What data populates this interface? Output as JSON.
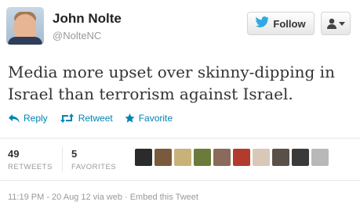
{
  "user": {
    "name": "John Nolte",
    "handle": "@NolteNC"
  },
  "buttons": {
    "follow_label": "Follow"
  },
  "tweet": {
    "text": "Media more upset over skinny-dipping in Israel than terrorism against Israel."
  },
  "actions": {
    "reply": "Reply",
    "retweet": "Retweet",
    "favorite": "Favorite"
  },
  "stats": {
    "retweets_count": "49",
    "retweets_label": "RETWEETS",
    "favorites_count": "5",
    "favorites_label": "FAVORITES"
  },
  "faces": [
    {
      "color": "#2b2b2b"
    },
    {
      "color": "#7a5a3c"
    },
    {
      "color": "#c9b27a"
    },
    {
      "color": "#6b7b3a"
    },
    {
      "color": "#8a6a5a"
    },
    {
      "color": "#b23b2e"
    },
    {
      "color": "#d9c7b8"
    },
    {
      "color": "#5a5048"
    },
    {
      "color": "#3a3a3a"
    },
    {
      "color": "#b8b8b8"
    }
  ],
  "meta": {
    "text": "11:19 PM - 20 Aug 12 via web · Embed this Tweet"
  },
  "colors": {
    "link": "#0084b4",
    "twitter_blue": "#2fa9e2"
  }
}
